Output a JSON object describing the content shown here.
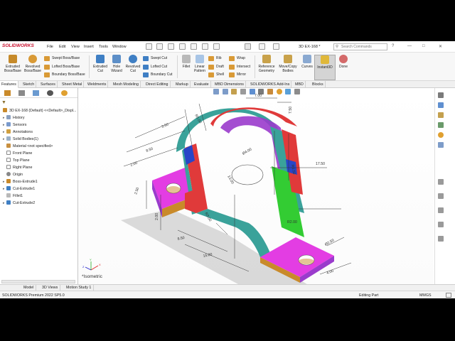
{
  "app": {
    "logo_text": "SOLIDWORKS",
    "doc_title": "3D EX-168 *"
  },
  "menu": [
    "File",
    "Edit",
    "View",
    "Insert",
    "Tools",
    "Window"
  ],
  "search": {
    "placeholder": "Search Commands"
  },
  "toolbar": {
    "extruded_boss": "Extruded\nBoss/Base",
    "revolved_boss": "Revolved\nBoss/Base",
    "swept_boss": "Swept Boss/Base",
    "lofted_boss": "Lofted Boss/Base",
    "boundary_boss": "Boundary Boss/Base",
    "extruded_cut": "Extruded\nCut",
    "hole_wizard": "Hole\nWizard",
    "revolved_cut": "Revolved\nCut",
    "swept_cut": "Swept Cut",
    "lofted_cut": "Lofted Cut",
    "boundary_cut": "Boundary Cut",
    "fillet": "Fillet",
    "linear_pattern": "Linear\nPattern",
    "rib": "Rib",
    "draft": "Draft",
    "shell": "Shell",
    "wrap": "Wrap",
    "intersect": "Intersect",
    "mirror": "Mirror",
    "reference_geometry": "Reference\nGeometry",
    "move_copy": "Move/Copy\nBodies",
    "curves": "Curves",
    "instant3d": "Instant3D",
    "done": "Done"
  },
  "tabs": [
    "Features",
    "Sketch",
    "Surfaces",
    "Sheet Metal",
    "Weldments",
    "Mesh Modeling",
    "Direct Editing",
    "Markup",
    "Evaluate",
    "MBD Dimensions",
    "SOLIDWORKS Add-Ins",
    "MBD",
    "Blocks"
  ],
  "tree": {
    "root": "3D EX-168 (Default) <<Default>_Displ...",
    "items": [
      "History",
      "Sensors",
      "Annotations",
      "Solid Bodies(1)",
      "Material <not specified>",
      "Front Plane",
      "Top Plane",
      "Right Plane",
      "Origin",
      "Boss-Extrude1",
      "Cut-Extrude1",
      "Fillet1",
      "Cut-Extrude2"
    ]
  },
  "viewport": {
    "view_label": "*Isometric",
    "dimensions": [
      "3.50",
      "R5.00",
      "7.00",
      "7.50",
      "Ø4.00",
      "R6.50",
      "17.50",
      "13.00",
      "R3.00",
      "2.50",
      "8.50",
      "15.00",
      "R2.00",
      "8.50",
      "Ø2.50",
      "4.00",
      "2.00",
      "2.00"
    ],
    "triad": {
      "x": "X",
      "y": "Y",
      "z": "Z"
    }
  },
  "bottom_tabs": [
    "Model",
    "3D Views",
    "Motion Study 1"
  ],
  "status": {
    "left": "SOLIDWORKS Premium 2022 SP5.0",
    "mid": "Editing Part",
    "units": "MMGS"
  },
  "colors": {
    "accent_red": "#c8102e",
    "face_red": "#e03a3a",
    "face_green": "#33cc33",
    "face_magenta": "#e33de3",
    "face_purple": "#9a3bcc",
    "face_teal": "#3aa29a"
  }
}
